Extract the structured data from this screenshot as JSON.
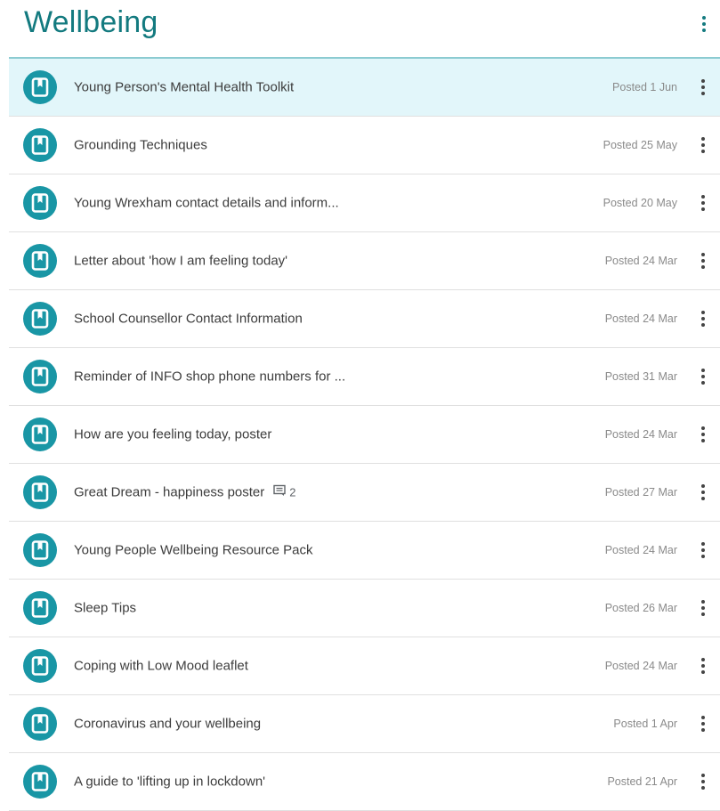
{
  "header": {
    "title": "Wellbeing"
  },
  "colors": {
    "accent": "#137a7f",
    "icon_bg": "#1996a5",
    "selected_bg": "#e2f6fa"
  },
  "items": [
    {
      "title": "Young Person's Mental Health Toolkit",
      "posted": "Posted 1 Jun",
      "selected": true,
      "icon": "material-icon"
    },
    {
      "title": "Grounding Techniques",
      "posted": "Posted 25 May",
      "icon": "material-icon"
    },
    {
      "title": "Young Wrexham contact details and inform...",
      "posted": "Posted 20 May",
      "icon": "material-icon"
    },
    {
      "title": "Letter about 'how I am feeling today'",
      "posted": "Posted 24 Mar",
      "icon": "material-icon"
    },
    {
      "title": "School Counsellor Contact Information",
      "posted": "Posted 24 Mar",
      "icon": "material-icon"
    },
    {
      "title": "Reminder of INFO shop phone numbers for ...",
      "posted": "Posted 31 Mar",
      "icon": "material-icon"
    },
    {
      "title": "How are you feeling today, poster",
      "posted": "Posted 24 Mar",
      "icon": "material-icon"
    },
    {
      "title": "Great Dream - happiness poster",
      "posted": "Posted 27 Mar",
      "comments": "2",
      "icon": "material-icon"
    },
    {
      "title": "Young People Wellbeing Resource Pack",
      "posted": "Posted 24 Mar",
      "icon": "material-icon"
    },
    {
      "title": "Sleep Tips",
      "posted": "Posted 26 Mar",
      "icon": "material-icon"
    },
    {
      "title": "Coping with Low Mood leaflet",
      "posted": "Posted 24 Mar",
      "icon": "material-icon"
    },
    {
      "title": "Coronavirus and your wellbeing",
      "posted": "Posted 1 Apr",
      "icon": "material-icon"
    },
    {
      "title": "A guide to 'lifting up in lockdown'",
      "posted": "Posted 21 Apr",
      "icon": "material-icon"
    }
  ]
}
